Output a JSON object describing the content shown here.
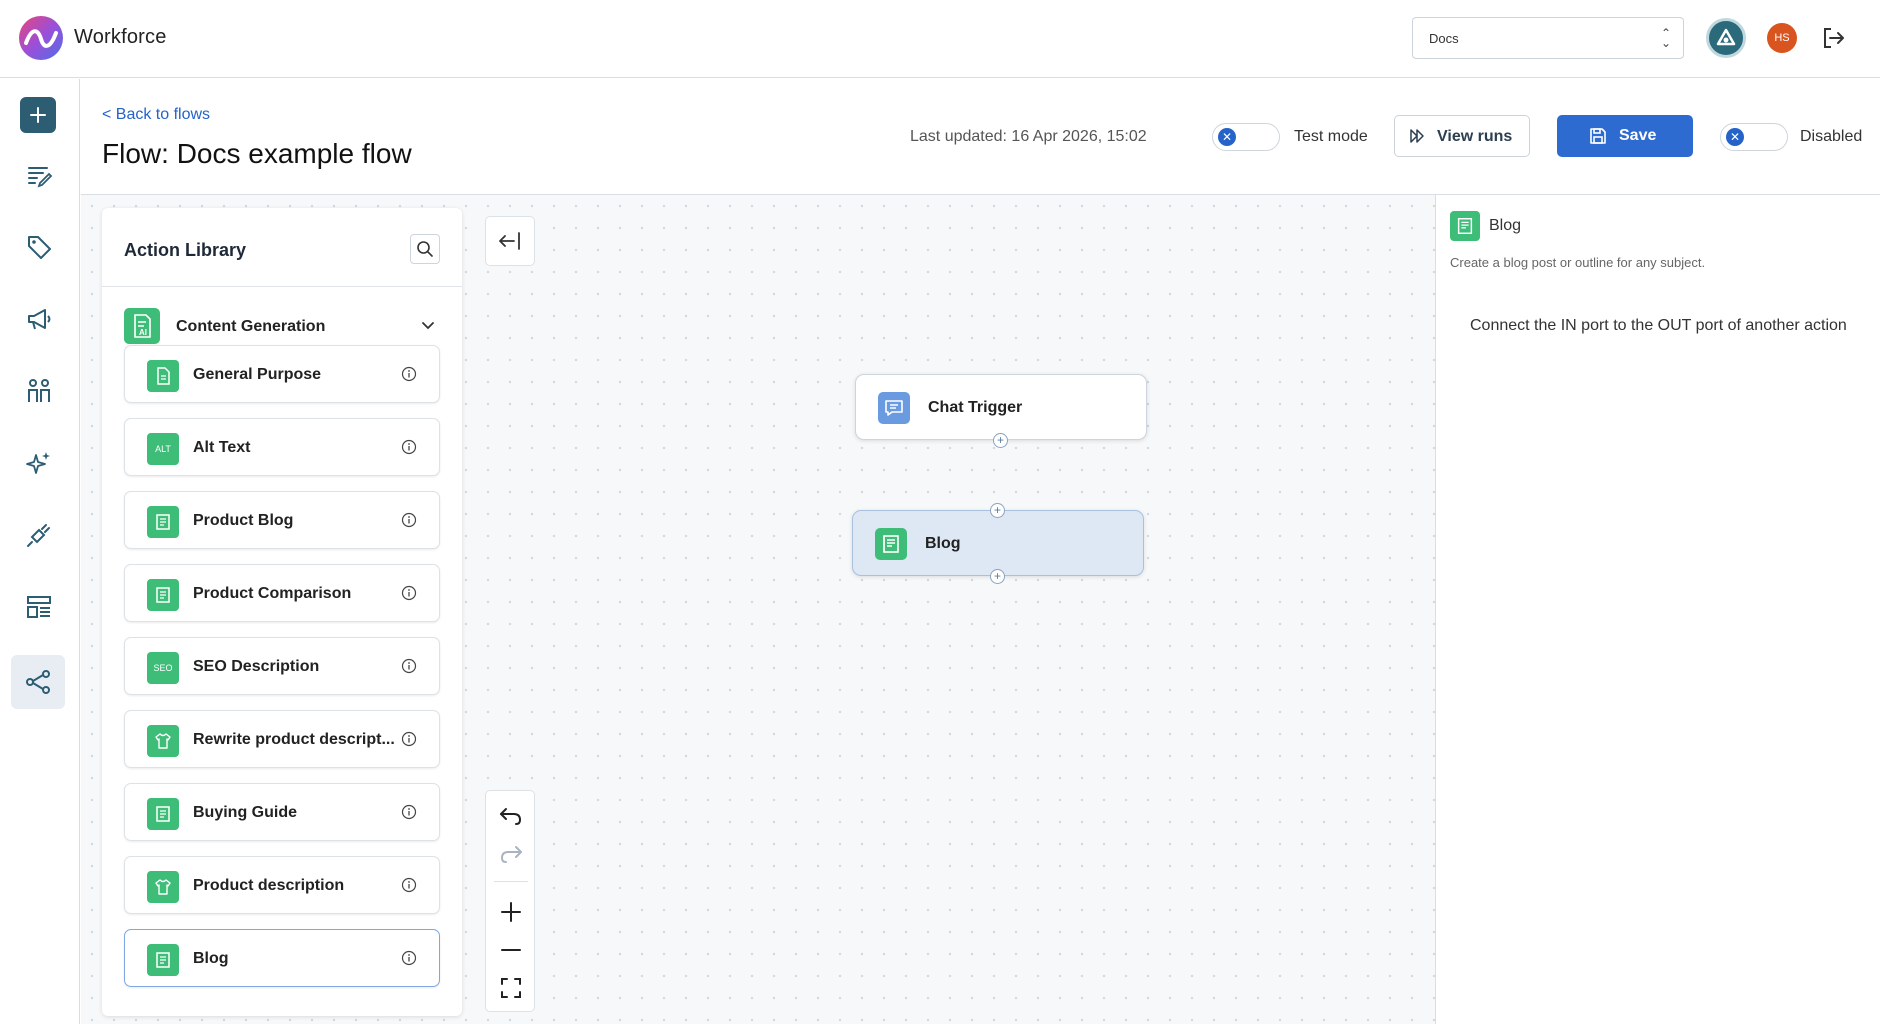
{
  "app": {
    "name": "Workforce",
    "workspace": "Docs",
    "avatar_initials": "HS",
    "accent_color": "#2d6bd0",
    "brand_color": "#2d5d73"
  },
  "nav": {
    "items": [
      "add",
      "content",
      "tags",
      "campaigns",
      "users",
      "ai",
      "integrations",
      "layouts",
      "flows"
    ],
    "active": "flows"
  },
  "header": {
    "back_link": "< Back to flows",
    "title_prefix": "Flow:",
    "title_name": "Docs example flow",
    "last_updated_label": "Last updated:",
    "last_updated_value": "16 Apr 2026, 15:02",
    "test_mode_label": "Test mode",
    "view_runs_label": "View runs",
    "save_label": "Save",
    "status_label": "Disabled"
  },
  "library": {
    "title": "Action Library",
    "category": "Content Generation",
    "items": [
      {
        "label": "General Purpose",
        "icon": "document-icon"
      },
      {
        "label": "Alt Text",
        "icon": "alt-text-icon",
        "badge": "ALT"
      },
      {
        "label": "Product Blog",
        "icon": "blog-icon"
      },
      {
        "label": "Product Comparison",
        "icon": "blog-icon"
      },
      {
        "label": "SEO Description",
        "icon": "seo-icon",
        "badge": "SEO"
      },
      {
        "label": "Rewrite product descript...",
        "icon": "shirt-icon"
      },
      {
        "label": "Buying Guide",
        "icon": "blog-icon"
      },
      {
        "label": "Product description",
        "icon": "shirt-icon"
      },
      {
        "label": "Blog",
        "icon": "blog-icon",
        "selected": true
      }
    ]
  },
  "canvas": {
    "nodes": [
      {
        "label": "Chat Trigger",
        "icon": "chat-icon"
      },
      {
        "label": "Blog",
        "icon": "blog-icon",
        "selected": true
      }
    ]
  },
  "panel": {
    "title": "Blog",
    "description": "Create a blog post or outline for any subject.",
    "hint": "Connect the IN port to the OUT port of another action"
  }
}
